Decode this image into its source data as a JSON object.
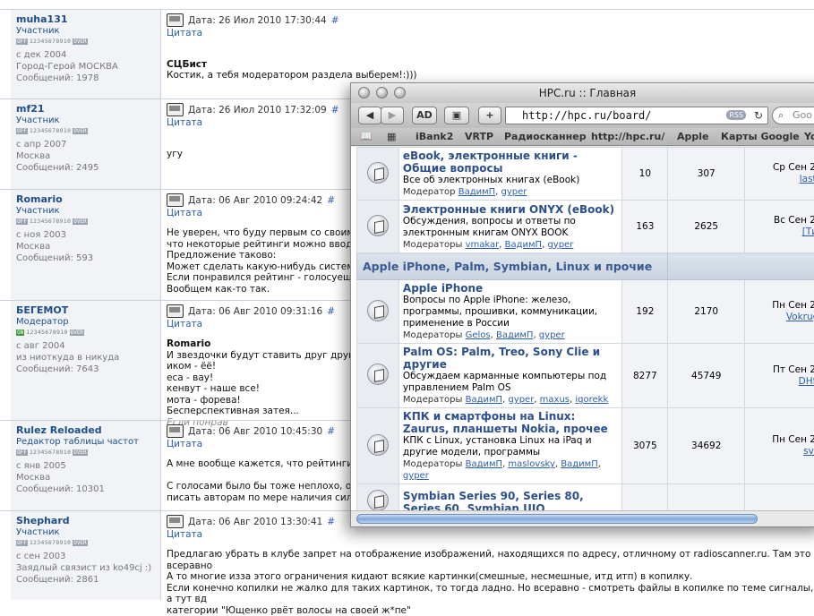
{
  "forum": {
    "posts": [
      {
        "user": "muha131",
        "title": "Участник",
        "rate_label": "OFF",
        "rate_digits": "12345678910",
        "rate_end": "OVER",
        "since": "с дек 2004",
        "location": "Город-Герой МОСКВА",
        "messages": "Сообщений: 1978",
        "date": "Дата: 26 Июл 2010 17:30:44",
        "hash": "#",
        "quote": "Цитата",
        "lines": [
          "",
          "СЦБист",
          "Костик, а тебя модератором раздела выберем!:)))"
        ]
      },
      {
        "user": "mf21",
        "title": "Участник",
        "rate_label": "OFF",
        "rate_digits": "12345678910",
        "rate_end": "OVER",
        "since": "с апр 2007",
        "location": "Москва",
        "messages": "Сообщений: 2495",
        "date": "Дата: 26 Июл 2010 17:32:09",
        "hash": "#",
        "quote": "Цитата",
        "lines": [
          "",
          "угу"
        ]
      },
      {
        "user": "Romario",
        "title": "Участник",
        "rate_label": "OFF",
        "rate_digits": "12345678910",
        "rate_end": "OVER",
        "since": "с ноя 2003",
        "location": "Москва",
        "messages": "Сообщений: 593",
        "date": "Дата: 06 Авг 2010 09:24:42",
        "hash": "#",
        "quote": "Цитата",
        "lines": [
          "Не уверен, что буду первым со своим п",
          "что некоторые рейтинги можно вводить",
          "Предложение таково:",
          "Может сделать какую-нибудь систему с",
          "Если понравился рейтинг - голосуешь \"",
          "Вообщем как-то так."
        ]
      },
      {
        "user": "БЕГЕМОТ",
        "title": "Модератор",
        "rate_label": "ON",
        "rate_digits": "12345678910",
        "rate_end": "OVER",
        "since": "с авг 2004",
        "location": "из ниоткуда в никуда",
        "messages": "Сообщений: 7643",
        "date": "Дата: 06 Авг 2010 09:31:16",
        "hash": "#",
        "quote": "Цитата",
        "lines": [
          "Romario",
          "И звездочки будут ставить друг другу",
          "иком - ёё!",
          "еса - вау!",
          "кенвут - наше все!",
          "мота - форева!",
          "Бесперспективная затея..."
        ],
        "edited": "Если понрав"
      },
      {
        "user": "Rulez Reloaded",
        "title": "Редактор таблицы частот",
        "rate_label": "OFF",
        "rate_digits": "12345678910",
        "rate_end": "OVER",
        "since": "с янв 2005",
        "location": "Москва",
        "messages": "Сообщений: 10301",
        "date": "Дата: 06 Авг 2010 10:45:30",
        "hash": "#",
        "quote": "Цитата",
        "lines": [
          "А мне вообще кажется, что рейтинги м",
          "",
          "С голосами было бы тоже неплохо, осо",
          "писать авторам по мере наличия сил/в"
        ]
      },
      {
        "user": "Shephard",
        "title": "Участник",
        "rate_label": "OFF",
        "rate_digits": "12345678910",
        "rate_end": "OVER",
        "since": "с сен 2003",
        "location": "Заядлый связист из ko49cj :)",
        "messages": "Сообщений: 2861",
        "date": "Дата: 06 Авг 2010 13:30:41",
        "hash": "#",
        "quote": "Цитата",
        "lines": [
          "Предлагаю убрать в клубе запрет на отображение изображений, находящихся по адресу, отличному от radioscanner.ru. Там это всеравно",
          "А то многие изза этого ограничения кидают всякие картинки(смешные, несмешные, итд итп) в копилку.",
          "Если конечно копилки не жалко для таких картинок, то тогда ладно. Но всеравно - смотреть файлы в копилке по теме сигналы, а тут вд",
          "категории \"Ющенко рвёт волосы на своей ж*пе\""
        ]
      }
    ]
  },
  "browser": {
    "window_title": "HPC.ru :: Главная",
    "ad_label": "AD",
    "plus_label": "+",
    "url": "http://hpc.ru/board/",
    "rss_label": "RSS",
    "search_placeholder": "Goo",
    "bookmarks": [
      "iBank2",
      "VRTP",
      "Радиосканнер",
      "http://hpc.ru/",
      "Apple",
      "Карты Google",
      "Yo"
    ],
    "forums": [
      {
        "title": "eBook, электронные книги - Общие вопросы",
        "desc": "Все об электронных книгах (eBook)",
        "mod_label": "Модератор",
        "mods": [
          "ВадимП",
          "gyper"
        ],
        "topics": "10",
        "posts": "307",
        "last_date": "Ср Сен 29,",
        "last_user": "lastio"
      },
      {
        "title": "Электронные книги ONYX (eBook)",
        "desc": "Обсуждения, вопросы и ответы по электронным книгам ONYX BOOK",
        "mod_label": "Модераторы",
        "mods": [
          "vmakar",
          "ВадимП",
          "gyper"
        ],
        "topics": "163",
        "posts": "2625",
        "last_date": "Вс Сен 26,",
        "last_user": "[Тим"
      },
      {
        "category": "Apple iPhone, Palm, Symbian, Linux и прочие"
      },
      {
        "title": "Apple iPhone",
        "desc": "Вопросы по Apple iPhone: железо, программы, прошивки, коммуникации, применение в России",
        "mod_label": "Модераторы",
        "mods": [
          "Gelos",
          "ВадимП",
          "gyper"
        ],
        "topics": "192",
        "posts": "2170",
        "last_date": "Пн Сен 27,",
        "last_user": "VokrugS"
      },
      {
        "title": "Palm OS: Palm, Treo, Sony Clie и другие",
        "desc": "Обсуждаем карманные компьютеры под управлением Palm OS",
        "mod_label": "Модераторы",
        "mods": [
          "ВадимП",
          "gyper",
          "maxus",
          "igorekk"
        ],
        "topics": "8277",
        "posts": "45749",
        "last_date": "Пт Сен 24,",
        "last_user": "DHS6"
      },
      {
        "title": "КПК и смартфоны на Linux: Zaurus, планшеты Nokia, прочее",
        "desc": "КПК с Linux, установка Linux на iPaq и другие модели, программы",
        "mod_label": "Модераторы",
        "mods": [
          "ВадимП",
          "maslovsky",
          "ВадимП",
          "gyper"
        ],
        "topics": "3075",
        "posts": "34692",
        "last_date": "Пн Сен 27,",
        "last_user": "svs5"
      },
      {
        "title": "Symbian Series 90, Series 80, Series 60, Symbian UIQ",
        "desc": "",
        "mod_label": "",
        "mods": [],
        "topics": "",
        "posts": "",
        "last_date": "",
        "last_user": ""
      }
    ]
  }
}
